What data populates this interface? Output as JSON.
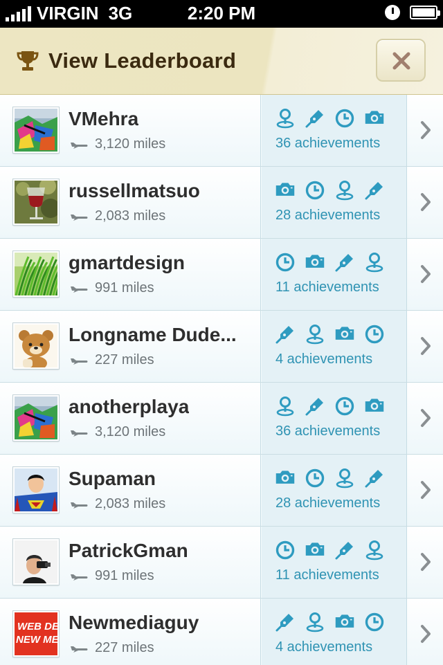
{
  "status_bar": {
    "carrier": "VIRGIN",
    "network": "3G",
    "time": "2:20 PM"
  },
  "header": {
    "title": "View Leaderboard",
    "trophy_icon": "trophy-icon",
    "close_icon": "close-icon",
    "accent": "#a08a68"
  },
  "colors": {
    "achievement_blue": "#2e9bc0",
    "name_text": "#2e2e2e",
    "miles_text": "#6d7478"
  },
  "leaderboard": [
    {
      "name": "VMehra",
      "miles": "3,120 miles",
      "achievements": "36 achievements",
      "avatar": "graffiti-avatar",
      "icons": [
        "pin-icon",
        "pen-icon",
        "clock-icon",
        "camera-icon"
      ]
    },
    {
      "name": "russellmatsuo",
      "miles": "2,083 miles",
      "achievements": "28 achievements",
      "avatar": "wine-glass-avatar",
      "icons": [
        "camera-icon",
        "clock-icon",
        "pin-icon",
        "pen-icon"
      ]
    },
    {
      "name": "gmartdesign",
      "miles": "991 miles",
      "achievements": "11 achievements",
      "avatar": "grass-avatar",
      "icons": [
        "clock-icon",
        "camera-icon",
        "pen-icon",
        "pin-icon"
      ]
    },
    {
      "name": "Longname Dude...",
      "miles": "227 miles",
      "achievements": "4 achievements",
      "avatar": "bear-avatar",
      "icons": [
        "pen-icon",
        "pin-icon",
        "camera-icon",
        "clock-icon"
      ]
    },
    {
      "name": "anotherplaya",
      "miles": "3,120 miles",
      "achievements": "36 achievements",
      "avatar": "graffiti-avatar",
      "icons": [
        "pin-icon",
        "pen-icon",
        "clock-icon",
        "camera-icon"
      ]
    },
    {
      "name": "Supaman",
      "miles": "2,083 miles",
      "achievements": "28 achievements",
      "avatar": "superman-avatar",
      "icons": [
        "camera-icon",
        "clock-icon",
        "pin-icon",
        "pen-icon"
      ]
    },
    {
      "name": "PatrickGman",
      "miles": "991 miles",
      "achievements": "11 achievements",
      "avatar": "person-avatar",
      "icons": [
        "clock-icon",
        "camera-icon",
        "pen-icon",
        "pin-icon"
      ]
    },
    {
      "name": "Newmediaguy",
      "miles": "227 miles",
      "achievements": "4 achievements",
      "avatar": "webdesign-avatar",
      "avatar_text": [
        "WEB DE",
        "NEW ME"
      ],
      "icons": [
        "pen-icon",
        "pin-icon",
        "camera-icon",
        "clock-icon"
      ]
    }
  ]
}
